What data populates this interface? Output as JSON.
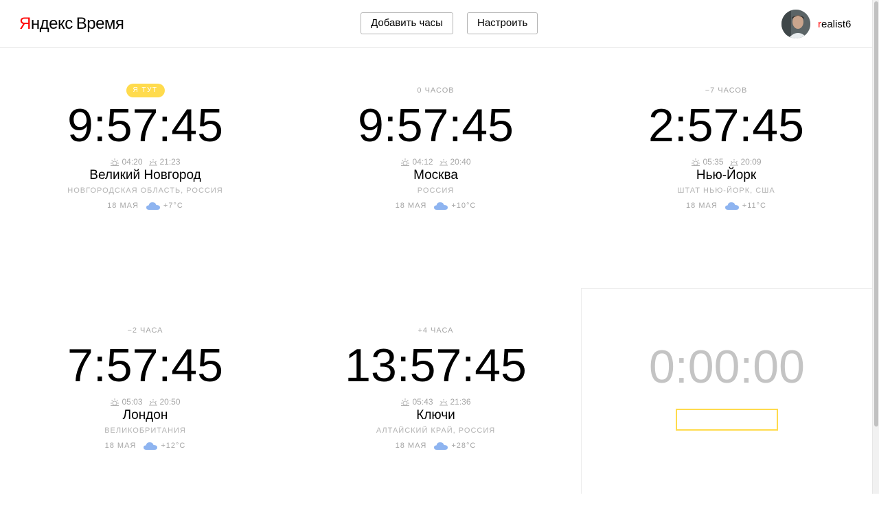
{
  "header": {
    "logo": {
      "ya": "Я",
      "brand": "ндекс",
      "service": "Время"
    },
    "add_clock_label": "Добавить часы",
    "settings_label": "Настроить",
    "user": {
      "name_first": "r",
      "name_rest": "ealist6"
    }
  },
  "clocks": [
    {
      "badge": "Я ТУТ",
      "offset": "",
      "time": "9:57:45",
      "sunrise": "04:20",
      "sunset": "21:23",
      "city": "Великий Новгород",
      "region": "НОВГОРОДСКАЯ ОБЛАСТЬ, РОССИЯ",
      "date": "18 МАЯ",
      "temp": "+7°C"
    },
    {
      "badge": "",
      "offset": "0 ЧАСОВ",
      "time": "9:57:45",
      "sunrise": "04:12",
      "sunset": "20:40",
      "city": "Москва",
      "region": "РОССИЯ",
      "date": "18 МАЯ",
      "temp": "+10°C"
    },
    {
      "badge": "",
      "offset": "−7 ЧАСОВ",
      "time": "2:57:45",
      "sunrise": "05:35",
      "sunset": "20:09",
      "city": "Нью-Йорк",
      "region": "ШТАТ НЬЮ-ЙОРК, США",
      "date": "18 МАЯ",
      "temp": "+11°C"
    },
    {
      "badge": "",
      "offset": "−2 ЧАСА",
      "time": "7:57:45",
      "sunrise": "05:03",
      "sunset": "20:50",
      "city": "Лондон",
      "region": "ВЕЛИКОБРИТАНИЯ",
      "date": "18 МАЯ",
      "temp": "+12°C"
    },
    {
      "badge": "",
      "offset": "+4 ЧАСА",
      "time": "13:57:45",
      "sunrise": "05:43",
      "sunset": "21:36",
      "city": "Ключи",
      "region": "АЛТАЙСКИЙ КРАЙ, РОССИЯ",
      "date": "18 МАЯ",
      "temp": "+28°C"
    }
  ],
  "timer": {
    "value": "0:00:00",
    "input_value": ""
  },
  "colors": {
    "accent_yellow": "#ffdb4d",
    "logo_red": "#ff0000",
    "weather_blue": "#8eb4f0"
  },
  "icons": {
    "sunrise": "sunrise-icon",
    "sunset": "sunset-icon",
    "weather": "cloud-icon"
  }
}
